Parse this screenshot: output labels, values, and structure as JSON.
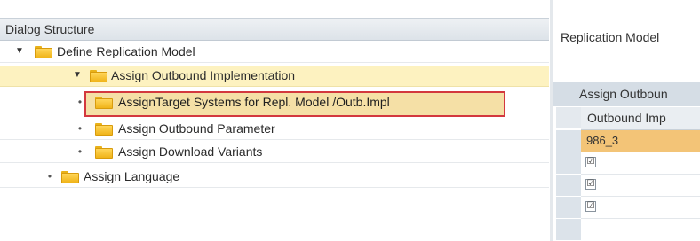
{
  "left_panel": {
    "header": "Dialog Structure",
    "tree": [
      {
        "label": "Define Replication Model",
        "level": 0,
        "expanded": true
      },
      {
        "label": "Assign Outbound Implementation",
        "level": 1,
        "expanded": true
      },
      {
        "label": "AssignTarget Systems for Repl. Model /Outb.Impl",
        "level": 2,
        "selected": true
      },
      {
        "label": "Assign Outbound Parameter",
        "level": 2
      },
      {
        "label": "Assign Download Variants",
        "level": 2
      },
      {
        "label": "Assign Language",
        "level": 1
      }
    ],
    "icons": {
      "expand": "expand-arrow-icon",
      "bullet": "tree-bullet-icon",
      "folder": "folder-icon"
    }
  },
  "right_panel": {
    "replication_model_label": "Replication Model",
    "section_title": "Assign Outboun",
    "column_header": "Outbound Imp",
    "rows": [
      {
        "value": "986_3"
      },
      {
        "checkbox": "☑"
      },
      {
        "checkbox": "☑"
      },
      {
        "checkbox": "☑"
      }
    ]
  },
  "colors": {
    "highlight_border": "#d3383e",
    "selected_row": "#fdf2c0",
    "value_cell": "#f3c477",
    "folder": "#f0b419"
  }
}
